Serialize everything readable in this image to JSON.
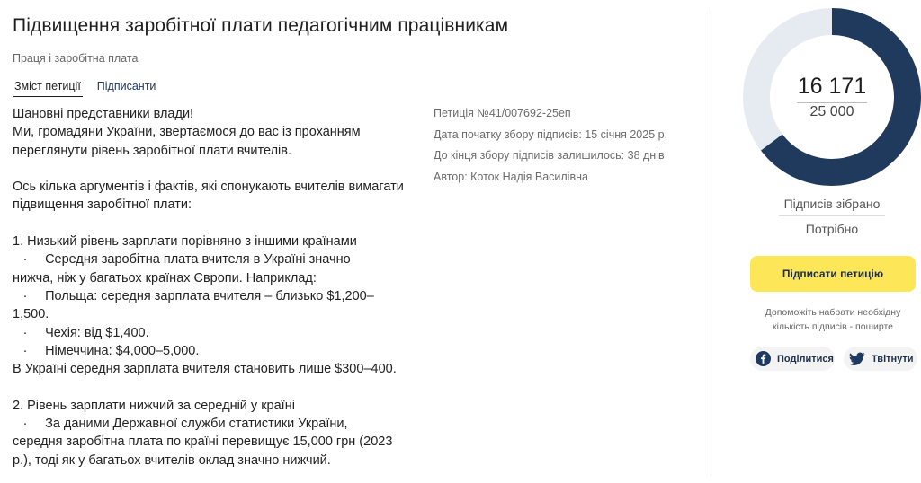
{
  "petition": {
    "title": "Підвищення заробітної плати педагогічним працівникам",
    "category": "Праця і заробітна плата",
    "tabs": [
      {
        "label": "Зміст петиції",
        "active": true
      },
      {
        "label": "Підписанти",
        "active": false
      }
    ],
    "body_lines": [
      "Шановні представники влади!",
      "Ми, громадяни України, звертаємося до вас із проханням",
      "переглянути рівень заробітної плати вчителів.",
      "",
      "Ось кілька аргументів і фактів, які спонукають вчителів вимагати",
      "підвищення заробітної плати:",
      "",
      "1. Низький рівень зарплати порівняно з іншими країнами",
      "Середня заробітна плата вчителя в Україні значно",
      "нижча, ніж у багатьох країнах Європи. Наприклад:",
      "Польща: середня зарплата вчителя – близько $1,200–",
      "1,500.",
      "Чехія: від $1,400.",
      "Німеччина: $4,000–5,000.",
      "В Україні середня зарплата вчителя становить лише $300–400.",
      "",
      "2. Рівень зарплати нижчий за середній у країні",
      "За даними Державної служби статистики України,",
      "середня заробітна плата по країні перевищує 15,000 грн (2023",
      "р.), тоді як у багатьох вчителів оклад значно нижчий."
    ],
    "bullet_glyph": "·",
    "meta": {
      "number": "Петиція №41/007692-25еп",
      "start_date": "Дата початку збору підписів: 15 січня 2025 р.",
      "days_left": "До кінця збору підписів залишилось: 38 днів",
      "author": "Автор: Коток Надія Василівна"
    }
  },
  "signatures": {
    "collected_display": "16 171",
    "needed_display": "25 000",
    "progress_fraction": 0.6468,
    "collected_label": "Підписів зібрано",
    "needed_label": "Потрібно",
    "sign_button": "Підписати петицію",
    "help_line1": "Допоможіть набрати необхідну",
    "help_line2": "кількість підписів - поширте",
    "share_facebook": "Поділитися",
    "share_twitter": "Твітнути",
    "icons": {
      "facebook": "facebook-icon",
      "twitter": "twitter-icon"
    }
  },
  "colors": {
    "progress": "#1f3a5c",
    "track": "#e6ebf1",
    "button": "#fde758",
    "tab_link": "#1f3a60"
  }
}
